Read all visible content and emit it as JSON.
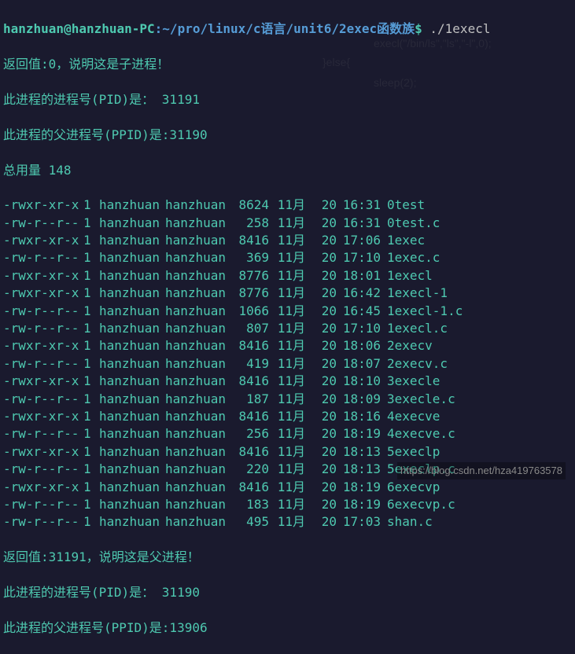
{
  "prompt": {
    "user_host": "hanzhuan@hanzhuan-PC",
    "colon": ":",
    "path": "~/pro/linux/c语言/unit6/2exec函数族",
    "symbol": "$",
    "command": " ./1execl"
  },
  "output": {
    "pre": [
      "返回值:0，说明这是子进程！",
      "此进程的进程号(PID)是： 31191",
      "此进程的父进程号(PPID)是:31190",
      "总用量 148"
    ],
    "post": [
      "返回值:31191，说明这是父进程！",
      "此进程的进程号(PID)是： 31190",
      "此进程的父进程号(PPID)是:13906"
    ]
  },
  "ls": [
    {
      "perm": "-rwxr-xr-x",
      "links": "1",
      "owner": "hanzhuan",
      "group": "hanzhuan",
      "size": "8624",
      "month": "11月",
      "day": "20",
      "time": "16:31",
      "name": "0test",
      "exec": true
    },
    {
      "perm": "-rw-r--r--",
      "links": "1",
      "owner": "hanzhuan",
      "group": "hanzhuan",
      "size": "258",
      "month": "11月",
      "day": "20",
      "time": "16:31",
      "name": "0test.c",
      "exec": false
    },
    {
      "perm": "-rwxr-xr-x",
      "links": "1",
      "owner": "hanzhuan",
      "group": "hanzhuan",
      "size": "8416",
      "month": "11月",
      "day": "20",
      "time": "17:06",
      "name": "1exec",
      "exec": true
    },
    {
      "perm": "-rw-r--r--",
      "links": "1",
      "owner": "hanzhuan",
      "group": "hanzhuan",
      "size": "369",
      "month": "11月",
      "day": "20",
      "time": "17:10",
      "name": "1exec.c",
      "exec": false
    },
    {
      "perm": "-rwxr-xr-x",
      "links": "1",
      "owner": "hanzhuan",
      "group": "hanzhuan",
      "size": "8776",
      "month": "11月",
      "day": "20",
      "time": "18:01",
      "name": "1execl",
      "exec": true
    },
    {
      "perm": "-rwxr-xr-x",
      "links": "1",
      "owner": "hanzhuan",
      "group": "hanzhuan",
      "size": "8776",
      "month": "11月",
      "day": "20",
      "time": "16:42",
      "name": "1execl-1",
      "exec": true
    },
    {
      "perm": "-rw-r--r--",
      "links": "1",
      "owner": "hanzhuan",
      "group": "hanzhuan",
      "size": "1066",
      "month": "11月",
      "day": "20",
      "time": "16:45",
      "name": "1execl-1.c",
      "exec": false
    },
    {
      "perm": "-rw-r--r--",
      "links": "1",
      "owner": "hanzhuan",
      "group": "hanzhuan",
      "size": "807",
      "month": "11月",
      "day": "20",
      "time": "17:10",
      "name": "1execl.c",
      "exec": false
    },
    {
      "perm": "-rwxr-xr-x",
      "links": "1",
      "owner": "hanzhuan",
      "group": "hanzhuan",
      "size": "8416",
      "month": "11月",
      "day": "20",
      "time": "18:06",
      "name": "2execv",
      "exec": true
    },
    {
      "perm": "-rw-r--r--",
      "links": "1",
      "owner": "hanzhuan",
      "group": "hanzhuan",
      "size": "419",
      "month": "11月",
      "day": "20",
      "time": "18:07",
      "name": "2execv.c",
      "exec": false
    },
    {
      "perm": "-rwxr-xr-x",
      "links": "1",
      "owner": "hanzhuan",
      "group": "hanzhuan",
      "size": "8416",
      "month": "11月",
      "day": "20",
      "time": "18:10",
      "name": "3execle",
      "exec": true
    },
    {
      "perm": "-rw-r--r--",
      "links": "1",
      "owner": "hanzhuan",
      "group": "hanzhuan",
      "size": "187",
      "month": "11月",
      "day": "20",
      "time": "18:09",
      "name": "3execle.c",
      "exec": false
    },
    {
      "perm": "-rwxr-xr-x",
      "links": "1",
      "owner": "hanzhuan",
      "group": "hanzhuan",
      "size": "8416",
      "month": "11月",
      "day": "20",
      "time": "18:16",
      "name": "4execve",
      "exec": true
    },
    {
      "perm": "-rw-r--r--",
      "links": "1",
      "owner": "hanzhuan",
      "group": "hanzhuan",
      "size": "256",
      "month": "11月",
      "day": "20",
      "time": "18:19",
      "name": "4execve.c",
      "exec": false
    },
    {
      "perm": "-rwxr-xr-x",
      "links": "1",
      "owner": "hanzhuan",
      "group": "hanzhuan",
      "size": "8416",
      "month": "11月",
      "day": "20",
      "time": "18:13",
      "name": "5execlp",
      "exec": true
    },
    {
      "perm": "-rw-r--r--",
      "links": "1",
      "owner": "hanzhuan",
      "group": "hanzhuan",
      "size": "220",
      "month": "11月",
      "day": "20",
      "time": "18:13",
      "name": "5execlp.c",
      "exec": false
    },
    {
      "perm": "-rwxr-xr-x",
      "links": "1",
      "owner": "hanzhuan",
      "group": "hanzhuan",
      "size": "8416",
      "month": "11月",
      "day": "20",
      "time": "18:19",
      "name": "6execvp",
      "exec": true
    },
    {
      "perm": "-rw-r--r--",
      "links": "1",
      "owner": "hanzhuan",
      "group": "hanzhuan",
      "size": "183",
      "month": "11月",
      "day": "20",
      "time": "18:19",
      "name": "6execvp.c",
      "exec": false
    },
    {
      "perm": "-rw-r--r--",
      "links": "1",
      "owner": "hanzhuan",
      "group": "hanzhuan",
      "size": "495",
      "month": "11月",
      "day": "20",
      "time": "17:03",
      "name": "shan.c",
      "exec": false
    }
  ],
  "watermark": "https://blog.csdn.net/hza419763578",
  "ghost_code": {
    "line1": "execl(\"/bin/ls\",\"ls\",\"-l\",0);",
    "line2": "}else{",
    "line3": "sleep(2);"
  }
}
